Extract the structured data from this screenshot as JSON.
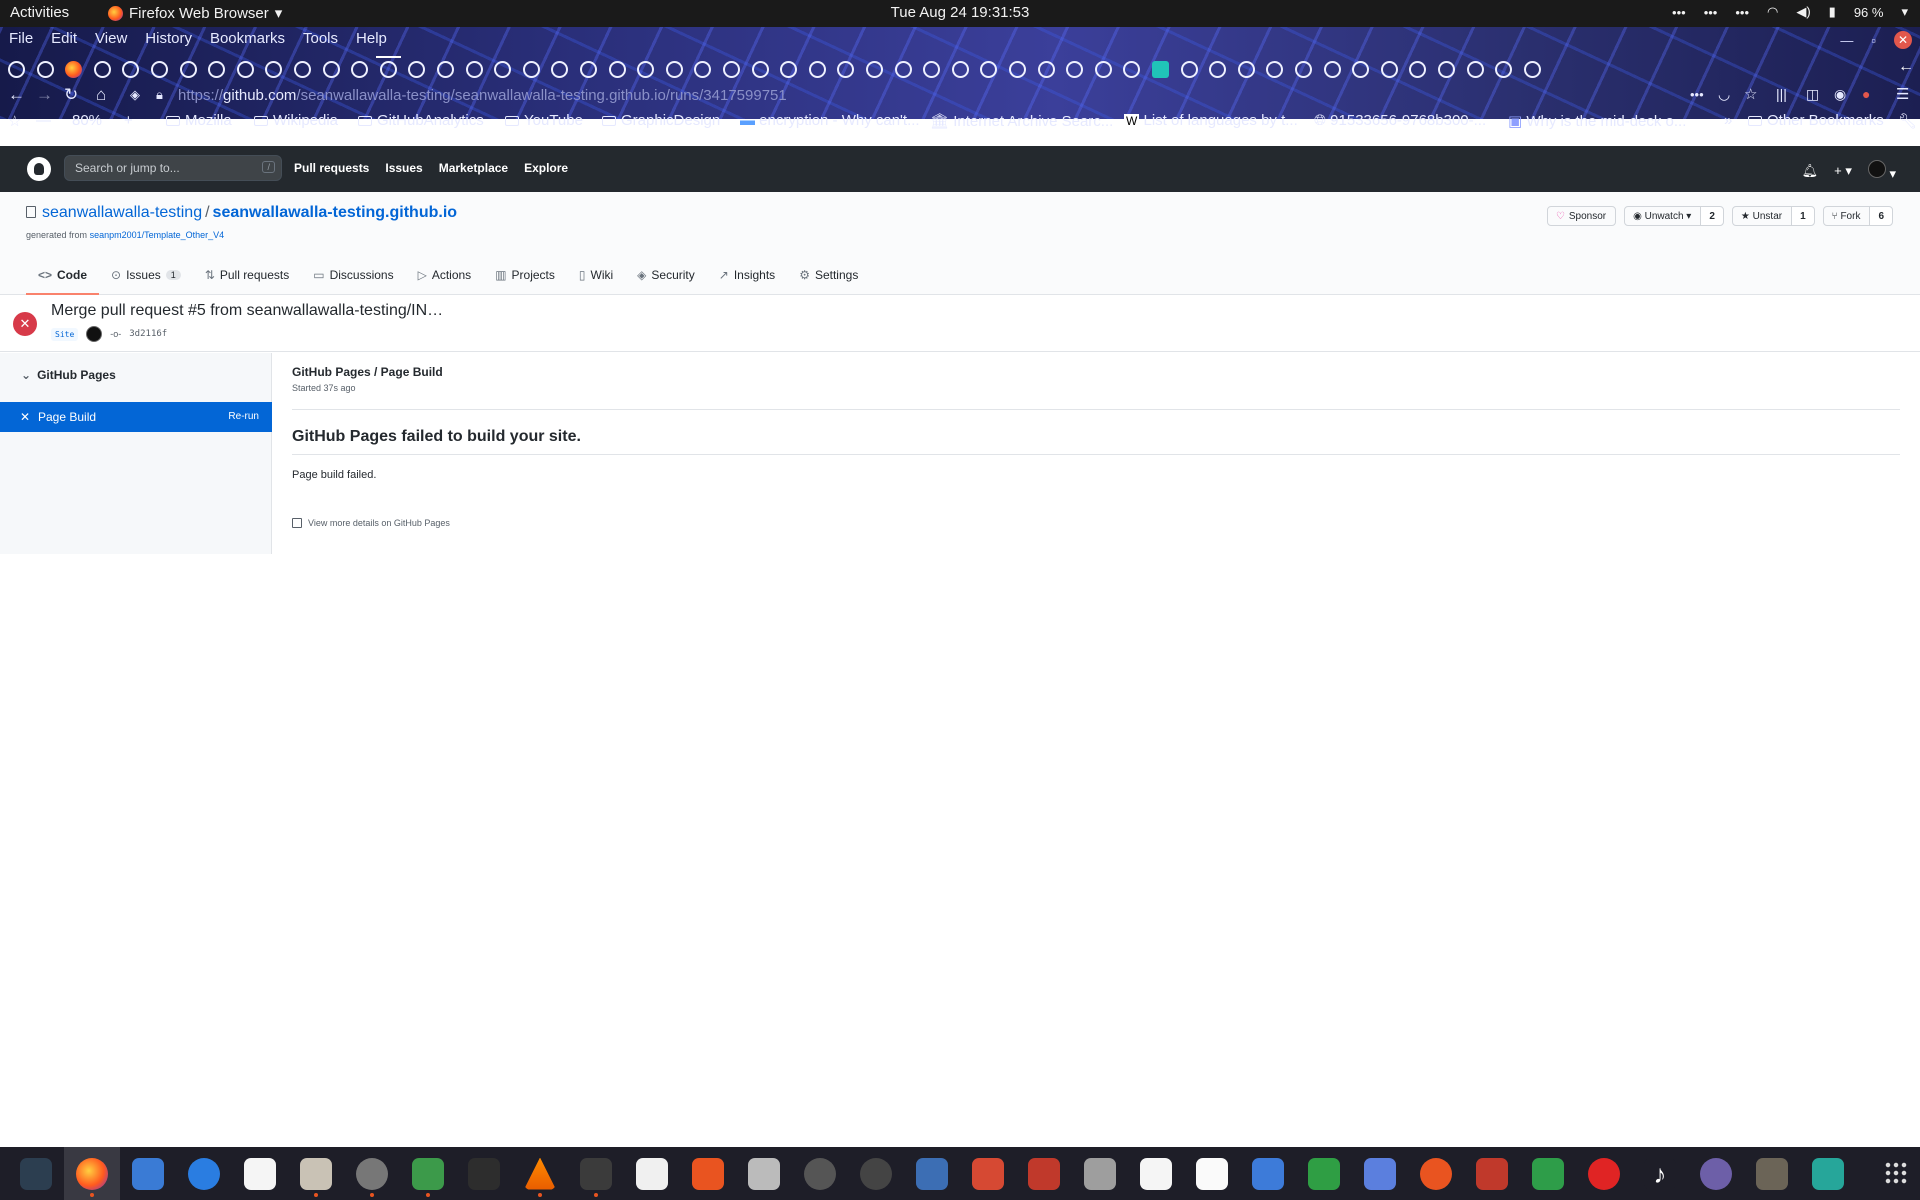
{
  "topbar": {
    "activities": "Activities",
    "app_name": "Firefox Web Browser",
    "clock": "Tue Aug 24  19:31:53",
    "battery": "96 %"
  },
  "browser": {
    "menu": [
      "File",
      "Edit",
      "View",
      "History",
      "Bookmarks",
      "Tools",
      "Help"
    ],
    "url_prefix": "https://",
    "url_host": "github.com",
    "url_path": "/seanwallawalla-testing/seanwallawalla-testing.github.io/runs/3417599751",
    "zoom": "80%",
    "bookmarks": [
      "Mozilla",
      "Wikipedia",
      "GitHubAnalytics",
      "YouTube",
      "GraphicDesign",
      "encryption - Why can't...",
      "Internet Archive Searc...",
      "List of languages by t...",
      "91533656-9768b300-...",
      "Why is the mid-deck o...",
      "Other Bookmarks"
    ]
  },
  "github": {
    "search_placeholder": "Search or jump to...",
    "search_key": "/",
    "nav": [
      "Pull requests",
      "Issues",
      "Marketplace",
      "Explore"
    ],
    "owner": "seanwallawalla-testing",
    "repo": "seanwallawalla-testing.github.io",
    "generated_from_label": "generated from",
    "generated_from_link": "seanpm2001/Template_Other_V4",
    "sponsor": "Sponsor",
    "watch": "Unwatch",
    "watch_count": "2",
    "star": "Unstar",
    "star_count": "1",
    "fork": "Fork",
    "fork_count": "6",
    "tabs": {
      "code": "Code",
      "issues": "Issues",
      "issues_count": "1",
      "pulls": "Pull requests",
      "discussions": "Discussions",
      "actions": "Actions",
      "projects": "Projects",
      "wiki": "Wiki",
      "security": "Security",
      "insights": "Insights",
      "settings": "Settings"
    }
  },
  "run": {
    "title": "Merge pull request #5 from seanwallawalla-testing/IN…",
    "label": "Site",
    "sha": "3d2116f"
  },
  "sidebar": {
    "workflow": "GitHub Pages",
    "job": "Page Build",
    "rerun": "Re-run"
  },
  "job": {
    "title": "GitHub Pages / Page Build",
    "started": "Started 37s ago",
    "fail_heading": "GitHub Pages failed to build your site.",
    "fail_message": "Page build failed.",
    "more_details": "View more details on GitHub Pages"
  },
  "colors": {
    "gh_header": "#24292e",
    "link": "#0366d6",
    "fail": "#d73a49",
    "tab_underline": "#f9826c"
  }
}
